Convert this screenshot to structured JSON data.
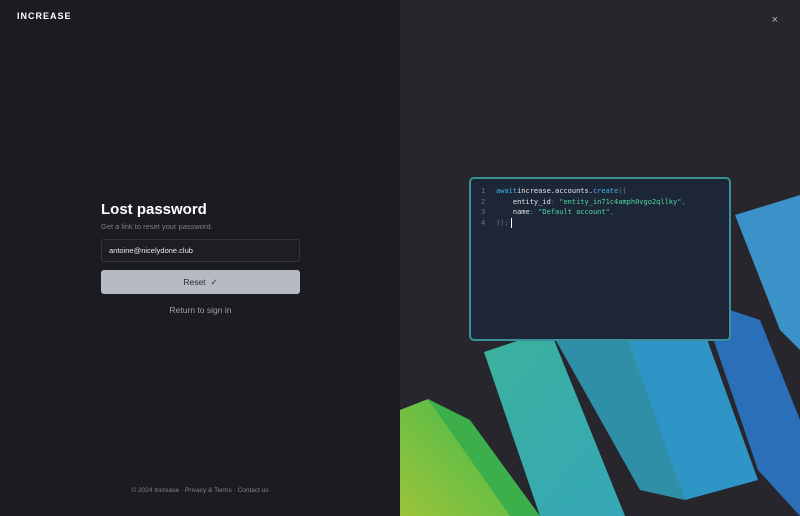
{
  "brand": "INCREASE",
  "form": {
    "title": "Lost password",
    "subtitle": "Get a link to reset your password.",
    "email_value": "antoine@nicelydone.club",
    "reset_label": "Reset",
    "return_label": "Return to sign in"
  },
  "footer": {
    "copyright": "© 2024 Increase",
    "sep1": "·",
    "privacy": "Privacy & Terms",
    "sep2": "·",
    "contact": "Contact us"
  },
  "close_icon": "×",
  "code": {
    "lines": [
      {
        "n": "1",
        "a": "await ",
        "b": "increase.accounts.",
        "c": "create",
        "d": "({"
      },
      {
        "n": "2",
        "a": "    entity_id",
        "b": ": ",
        "c": "\"entity_in71c4amph0vgo2qllky\"",
        "d": ","
      },
      {
        "n": "3",
        "a": "    name",
        "b": ": ",
        "c": "\"Default account\"",
        "d": ","
      },
      {
        "n": "4",
        "a": "});"
      }
    ]
  },
  "colors": {
    "accent_blue": "#3fb4f0",
    "accent_green": "#4ed7a6"
  }
}
